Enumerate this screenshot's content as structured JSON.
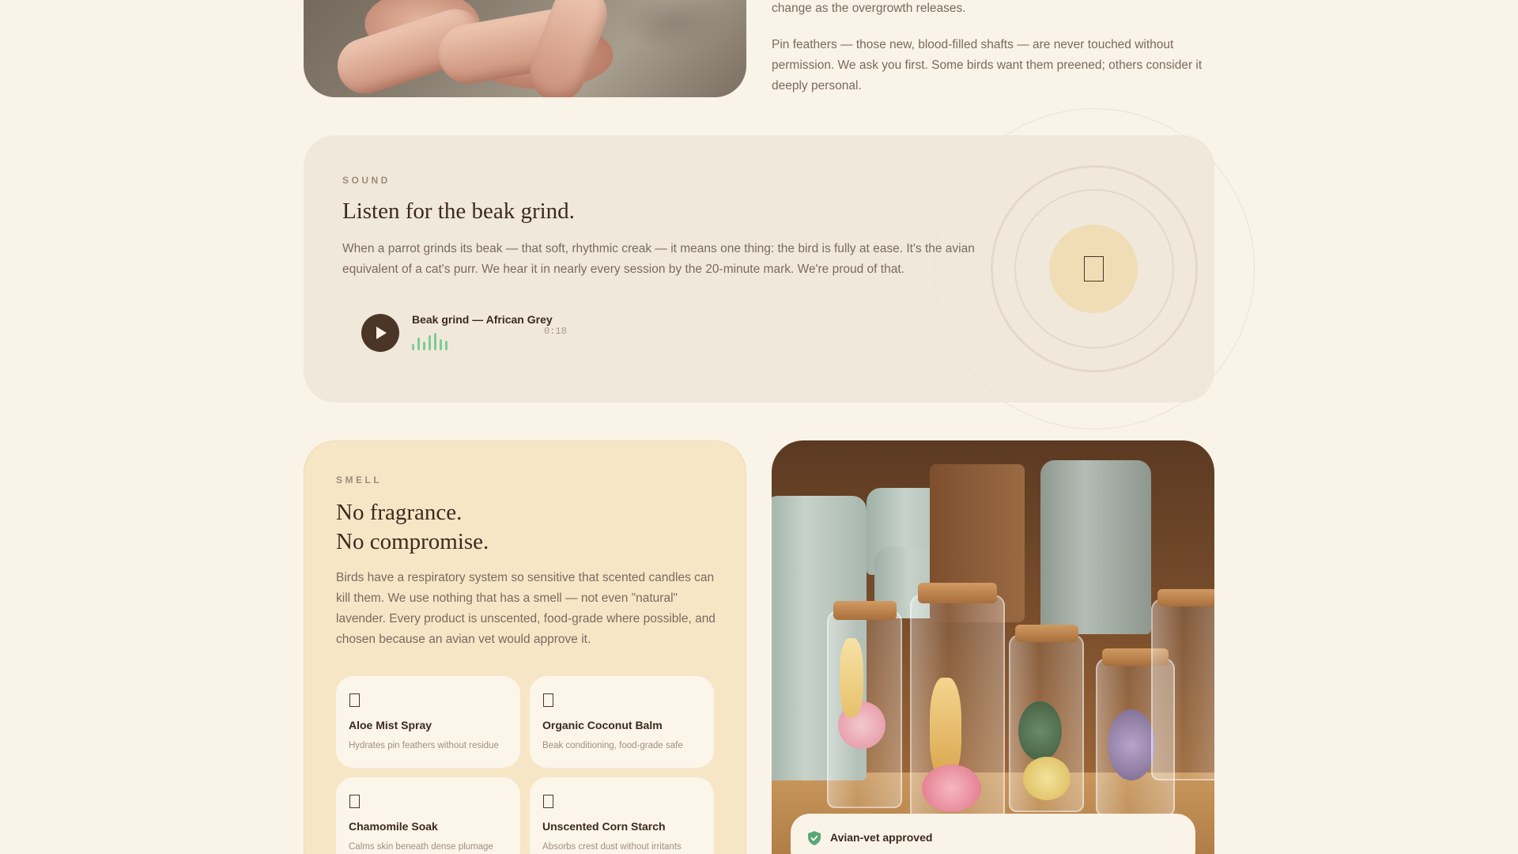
{
  "intro": {
    "paragraph_1_tail": "change as the overgrowth releases.",
    "paragraph_2": "Pin feathers — those new, blood-filled shafts — are never touched without permission. We ask you first. Some birds want them preened; others consider it deeply personal."
  },
  "sound": {
    "eyebrow": "SOUND",
    "title": "Listen for the beak grind.",
    "body": "When a parrot grinds its beak — that soft, rhythmic creak — it means one thing: the bird is fully at ease. It's the avian equivalent of a cat's purr. We hear it in nearly every session by the 20-minute mark. We're proud of that.",
    "player": {
      "track": "Beak grind — African Grey",
      "duration": "0:18",
      "waveform_color": "#7ccb9a"
    },
    "icon": "ear-icon"
  },
  "smell": {
    "eyebrow": "SMELL",
    "title_line_1": "No fragrance.",
    "title_line_2": "No compromise.",
    "body": "Birds have a respiratory system so sensitive that scented candles can kill them. We use nothing that has a smell — not even \"natural\" lavender. Every product is unscented, food-grade where possible, and chosen because an avian vet would approve it.",
    "products": [
      {
        "name": "Aloe Mist Spray",
        "desc": "Hydrates pin feathers without residue",
        "icon": "spray-icon"
      },
      {
        "name": "Organic Coconut Balm",
        "desc": "Beak conditioning, food-grade safe",
        "icon": "balm-icon"
      },
      {
        "name": "Chamomile Soak",
        "desc": "Calms skin beneath dense plumage",
        "icon": "soak-icon"
      },
      {
        "name": "Unscented Corn Starch",
        "desc": "Absorbs crest dust without irritants",
        "icon": "starch-icon"
      }
    ]
  },
  "badge": {
    "label": "Avian-vet approved",
    "icon": "shield-check-icon",
    "color": "#5aa877"
  },
  "colors": {
    "page_bg": "#faf3e7",
    "sound_card_bg": "#f1e8dc",
    "smell_card_bg": "#f7e6c6",
    "dark_brown": "#4a3526"
  }
}
